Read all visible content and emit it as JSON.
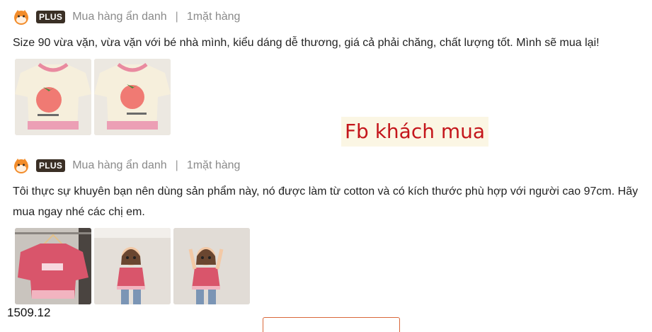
{
  "reviews": [
    {
      "badge": "PLUS",
      "reviewer": "Mua hàng ẩn danh",
      "separator": "|",
      "quantity": "1mặt hàng",
      "text": "Size 90 vừa vặn, vừa vặn với bé nhà mình, kiểu dáng dễ thương, giá cả phải chăng, chất lượng tốt. Mình sẽ mua lại!",
      "photos": [
        "cream-shirt-strawberry-photo",
        "cream-shirt-strawberry-photo"
      ]
    },
    {
      "badge": "PLUS",
      "reviewer": "Mua hàng ẩn danh",
      "separator": "|",
      "quantity": "1mặt hàng",
      "text": "Tôi thực sự khuyên bạn nên dùng sản phẩm này, nó được làm từ cotton và có kích thước phù hợp với người cao 97cm. Hãy mua ngay nhé các chị em.",
      "photos": [
        "pink-shirt-on-hanger-photo",
        "child-wearing-shirt-photo",
        "child-wearing-shirt-photo"
      ]
    }
  ],
  "watermark": "Fb khách mua",
  "price_label": "1509.12",
  "colors": {
    "badge_bg": "#3a2f25",
    "watermark_text": "#c4161c",
    "watermark_bg": "#fbf6e4",
    "button_border": "#d9673a"
  }
}
